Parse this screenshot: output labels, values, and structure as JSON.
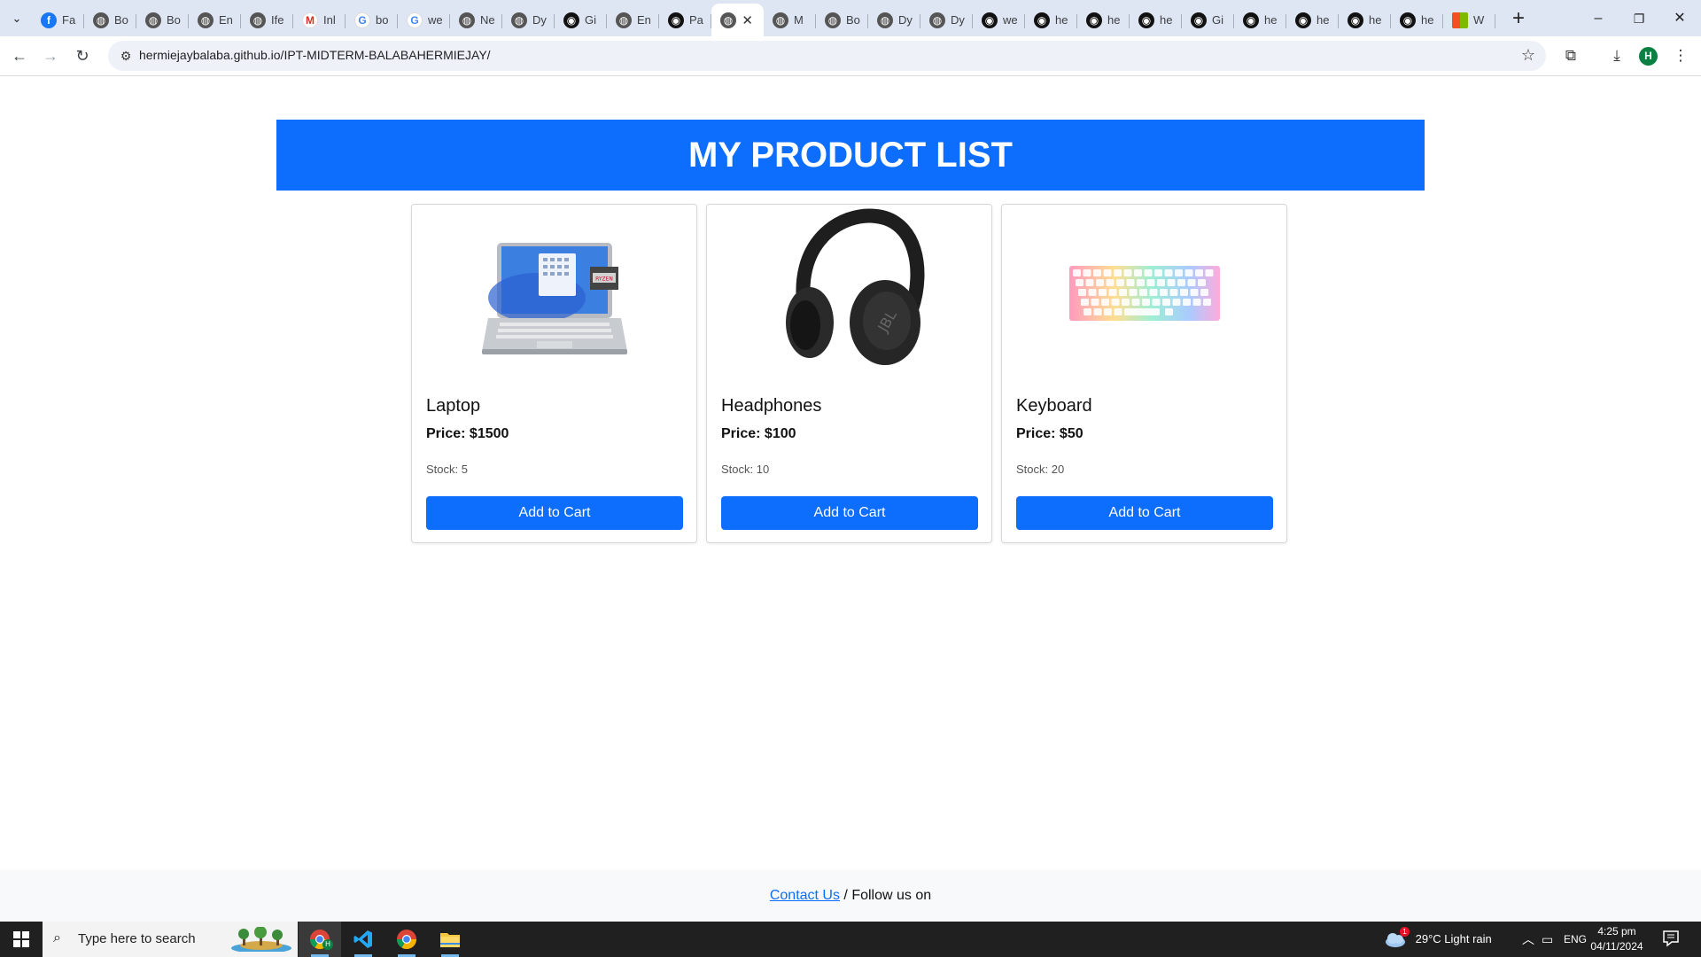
{
  "browser": {
    "tabs": [
      {
        "favicon": "facebook-icon",
        "title": "Fa"
      },
      {
        "favicon": "globe-icon",
        "title": "Bo"
      },
      {
        "favicon": "globe-icon",
        "title": "Bo"
      },
      {
        "favicon": "globe-icon",
        "title": "En"
      },
      {
        "favicon": "globe-icon",
        "title": "Ife"
      },
      {
        "favicon": "gmail-icon",
        "title": "Inl"
      },
      {
        "favicon": "google-icon",
        "title": "bo"
      },
      {
        "favicon": "google-icon",
        "title": "we"
      },
      {
        "favicon": "globe-icon",
        "title": "Ne"
      },
      {
        "favicon": "globe-icon",
        "title": "Dy"
      },
      {
        "favicon": "github-icon",
        "title": "Gi"
      },
      {
        "favicon": "globe-icon",
        "title": "En"
      },
      {
        "favicon": "github-icon",
        "title": "Pa"
      },
      {
        "favicon": "globe-icon",
        "title": "",
        "active": true
      },
      {
        "favicon": "globe-icon",
        "title": "M"
      },
      {
        "favicon": "globe-icon",
        "title": "Bo"
      },
      {
        "favicon": "globe-icon",
        "title": "Dy"
      },
      {
        "favicon": "globe-icon",
        "title": "Dy"
      },
      {
        "favicon": "github-icon",
        "title": "we"
      },
      {
        "favicon": "github-icon",
        "title": "he"
      },
      {
        "favicon": "github-icon",
        "title": "he"
      },
      {
        "favicon": "github-icon",
        "title": "he"
      },
      {
        "favicon": "github-icon",
        "title": "Gi"
      },
      {
        "favicon": "github-icon",
        "title": "he"
      },
      {
        "favicon": "github-icon",
        "title": "he"
      },
      {
        "favicon": "github-icon",
        "title": "he"
      },
      {
        "favicon": "github-icon",
        "title": "he"
      },
      {
        "favicon": "microsoft-icon",
        "title": "W"
      }
    ],
    "close_glyph": "✕",
    "url": "hermiejaybalaba.github.io/IPT-MIDTERM-BALABAHERMIEJAY/",
    "profile_initial": "H"
  },
  "page": {
    "header": "MY PRODUCT LIST",
    "products": [
      {
        "name": "Laptop",
        "price": "Price: $1500",
        "stock": "Stock: 5",
        "button": "Add to Cart"
      },
      {
        "name": "Headphones",
        "price": "Price: $100",
        "stock": "Stock: 10",
        "button": "Add to Cart"
      },
      {
        "name": "Keyboard",
        "price": "Price: $50",
        "stock": "Stock: 20",
        "button": "Add to Cart"
      }
    ],
    "footer": {
      "contact": "Contact Us",
      "follow": " / Follow us on"
    },
    "laptop_badge": "RYZEN"
  },
  "taskbar": {
    "search_placeholder": "Type here to search",
    "weather": "29°C  Light rain",
    "weather_badge": "1",
    "language": "ENG",
    "time": "4:25 pm",
    "date": "04/11/2024",
    "chrome_profile": "H"
  }
}
